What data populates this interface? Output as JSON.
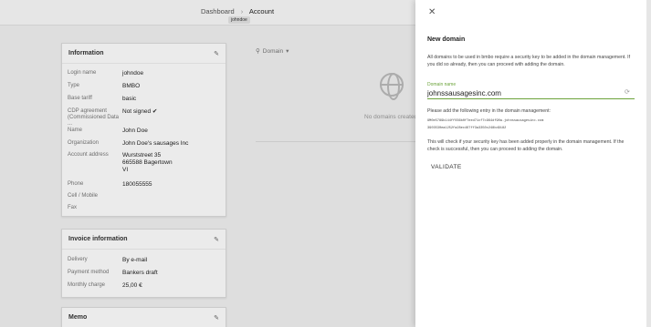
{
  "breadcrumb": {
    "dashboard": "Dashboard",
    "separator": "›",
    "current": "Account",
    "user_chip": "johndoe"
  },
  "information": {
    "title": "Information",
    "rows": [
      {
        "label": "Login name",
        "value": "johndoe"
      },
      {
        "label": "Type",
        "value": "BMBO"
      },
      {
        "label": "Base tariff",
        "value": "basic"
      },
      {
        "label": "CDP agreement (Commissioned Data ...",
        "value": "Not signed ✔"
      },
      {
        "label": "Name",
        "value": "John Doe"
      },
      {
        "label": "Organization",
        "value": "John Doe's sausages Inc"
      },
      {
        "label": "Account address",
        "value_lines": [
          "Wurststreet 35",
          "665588 Bagertown",
          "VI"
        ]
      },
      {
        "label": "Phone",
        "value": "180055555"
      },
      {
        "label": "Cell / Mobile",
        "value": ""
      },
      {
        "label": "Fax",
        "value": ""
      }
    ]
  },
  "invoice": {
    "title": "Invoice information",
    "rows": [
      {
        "label": "Delivery",
        "value": "By e-mail"
      },
      {
        "label": "Payment method",
        "value": "Bankers draft"
      },
      {
        "label": "Monthly charge",
        "value": "25,00 €"
      }
    ]
  },
  "memo": {
    "title": "Memo"
  },
  "domains": {
    "filter_label": "Domain",
    "empty_text": "No domains created y"
  },
  "drawer": {
    "title": "New domain",
    "intro": "All domains to be used in bmbo require a security key to be added in the domain management. If you did so already, then you can proceed with adding the domain.",
    "field_label": "Domain name",
    "field_value": "johnssausagesinc.com",
    "instruction": "Please add the following entry in the domain management:",
    "code_line1": "9M0e5789b144ff036b0f7eed71cf7c964df90a.johnssausagesinc.com",
    "code_line2": "3903530ea1252fa28ec467ff3a3350c248bd9182",
    "note": "This will check if your security key has been added properly in the domain management. If the check is successful, then you can proceed to adding the domain.",
    "validate_label": "VALIDATE"
  },
  "icons": {
    "edit": "pencil-icon",
    "close": "close-icon",
    "search": "search-icon",
    "globe": "globe-icon",
    "spinner": "refresh-icon"
  }
}
